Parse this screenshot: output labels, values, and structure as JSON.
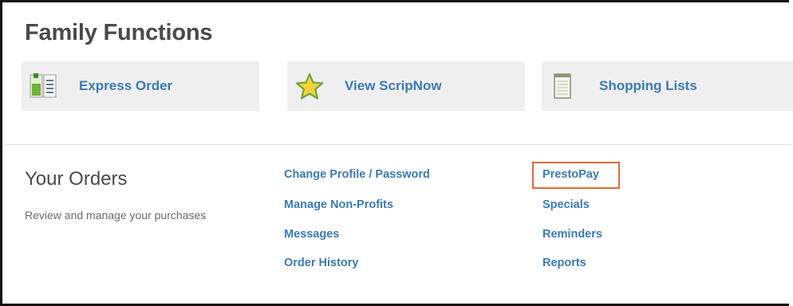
{
  "header": {
    "title": "Family Functions"
  },
  "tiles": [
    {
      "label": "Express Order",
      "icon": "express-order-icon"
    },
    {
      "label": "View ScripNow",
      "icon": "star-icon"
    },
    {
      "label": "Shopping Lists",
      "icon": "notepad-icon"
    }
  ],
  "orders": {
    "title": "Your Orders",
    "description": "Review and manage your purchases"
  },
  "links": {
    "col1": [
      "Change Profile / Password",
      "Manage Non-Profits",
      "Messages",
      "Order History"
    ],
    "col2": [
      "PrestoPay",
      "Specials",
      "Reminders",
      "Reports"
    ]
  },
  "highlighted_link": "PrestoPay",
  "colors": {
    "link": "#3a7ab8",
    "heading": "#4a4a4a",
    "tile_bg": "#efefef",
    "highlight_border": "#e06a35"
  }
}
